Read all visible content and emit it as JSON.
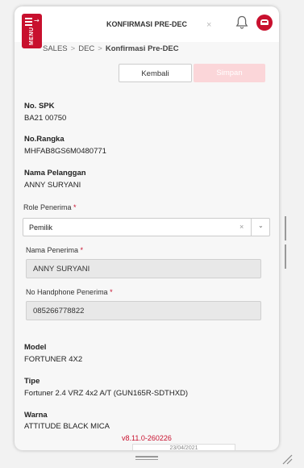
{
  "header": {
    "menu_label": "MENU",
    "tab_title": "KONFIRMASI PRE-DEC",
    "tab_close": "×"
  },
  "breadcrumb": {
    "items": [
      "SALES",
      "DEC",
      "Konfirmasi Pre-DEC"
    ],
    "separator": ">"
  },
  "actions": {
    "back_label": "Kembali",
    "save_label": "Simpan"
  },
  "details": {
    "spk_label": "No. SPK",
    "spk_value": "BA21 00750",
    "rangka_label": "No.Rangka",
    "rangka_value": "MHFAB8GS6M0480771",
    "customer_label": "Nama Pelanggan",
    "customer_value": "ANNY SURYANI",
    "model_label": "Model",
    "model_value": "FORTUNER 4X2",
    "type_label": "Tipe",
    "type_value": "Fortuner 2.4 VRZ 4x2 A/T (GUN165R-SDTHXD)",
    "color_label": "Warna",
    "color_value": "ATTITUDE BLACK MICA"
  },
  "form": {
    "role_label": "Role Penerima",
    "role_value": "Pemilik",
    "role_clear": "×",
    "receiver_name_label": "Nama Penerima",
    "receiver_name_value": "ANNY SURYANI",
    "receiver_phone_label": "No Handphone Penerima",
    "receiver_phone_value": "085266778822",
    "required_mark": "*"
  },
  "footer": {
    "version": "v8.11.0-260226",
    "peek_text": "23/04/2021"
  },
  "colors": {
    "accent": "#c8102e",
    "save_disabled": "#fbd6d9"
  }
}
